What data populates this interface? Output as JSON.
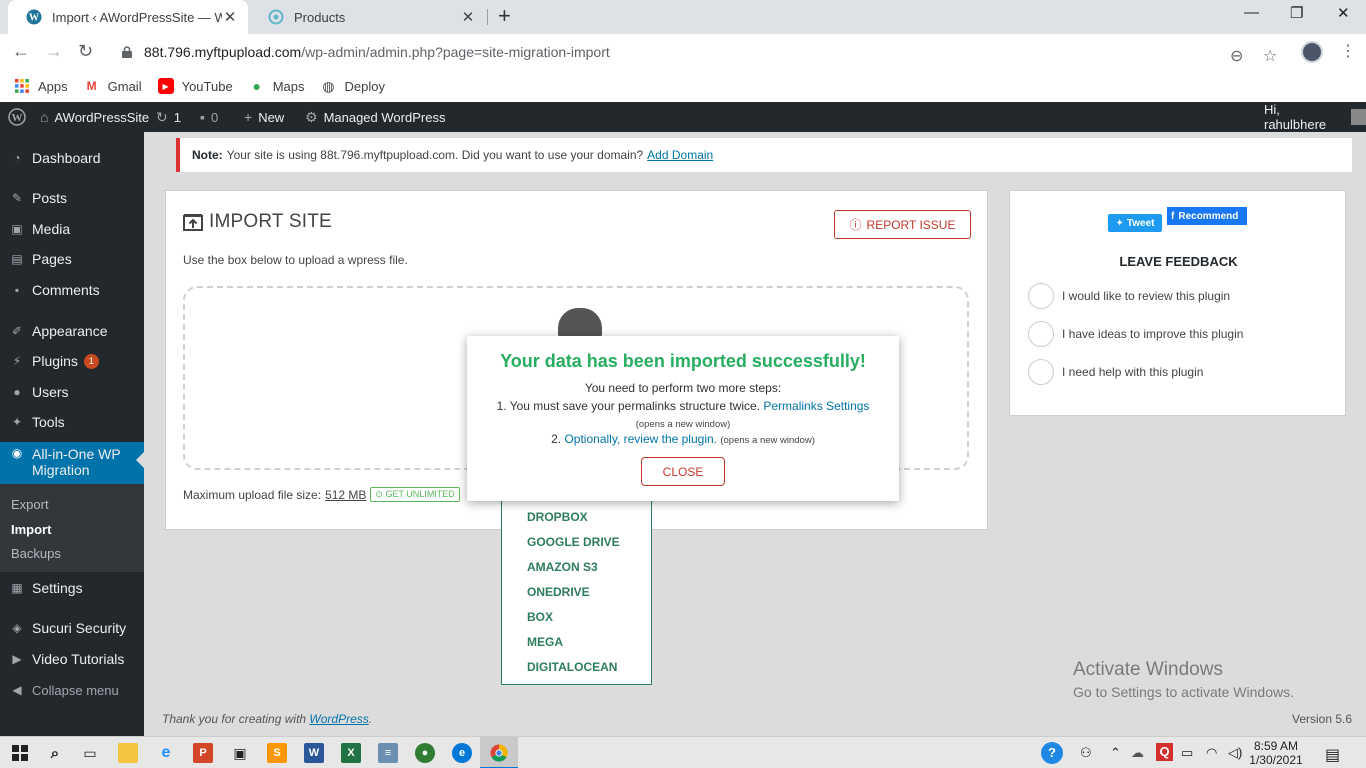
{
  "browser": {
    "tabs": [
      {
        "title": "Import ‹ AWordPressSite — WordPress"
      },
      {
        "title": "Products"
      }
    ],
    "url_host": "88t.796.myftpupload.com",
    "url_path": "/wp-admin/admin.php?page=site-migration-import",
    "bookmarks": [
      {
        "label": "Apps",
        "icon": "apps-grid-icon"
      },
      {
        "label": "Gmail",
        "icon": "gmail-icon"
      },
      {
        "label": "YouTube",
        "icon": "youtube-icon"
      },
      {
        "label": "Maps",
        "icon": "maps-pin-icon"
      },
      {
        "label": "Deploy",
        "icon": "deploy-globe-icon"
      }
    ]
  },
  "adminbar": {
    "site_name": "AWordPressSite",
    "updates_count": "1",
    "comments_count": "0",
    "new_label": "New",
    "managed_label": "Managed WordPress",
    "greeting": "Hi, rahulbhere"
  },
  "sidebar": {
    "items": [
      {
        "label": "Dashboard"
      },
      {
        "label": "Posts"
      },
      {
        "label": "Media"
      },
      {
        "label": "Pages"
      },
      {
        "label": "Comments"
      },
      {
        "label": "Appearance"
      },
      {
        "label": "Plugins",
        "badge": "1"
      },
      {
        "label": "Users"
      },
      {
        "label": "Tools"
      },
      {
        "label": "All-in-One WP Migration"
      },
      {
        "label": "Settings"
      },
      {
        "label": "Sucuri Security"
      },
      {
        "label": "Video Tutorials"
      },
      {
        "label": "Collapse menu"
      }
    ],
    "submenu": [
      "Export",
      "Import",
      "Backups"
    ]
  },
  "notice": {
    "label": "Note:",
    "text_before": "Your site is using",
    "domain": "88t.796.myftpupload.com.",
    "text_after": "Did you want to use your domain?",
    "link": "Add Domain"
  },
  "import_panel": {
    "title": "IMPORT SITE",
    "report_button": "REPORT ISSUE",
    "description": "Use the box below to upload a wpress file.",
    "max_upload_label": "Maximum upload file size:",
    "max_upload_value": "512 MB",
    "get_unlimited": "GET UNLIMITED",
    "providers": [
      "DROPBOX",
      "GOOGLE DRIVE",
      "AMAZON S3",
      "ONEDRIVE",
      "BOX",
      "MEGA",
      "DIGITALOCEAN"
    ]
  },
  "feedback_panel": {
    "tweet_label": "Tweet",
    "recommend_label": "Recommend",
    "title": "LEAVE FEEDBACK",
    "options": [
      "I would like to review this plugin",
      "I have ideas to improve this plugin",
      "I need help with this plugin"
    ]
  },
  "modal": {
    "title": "Your data has been imported successfully!",
    "subtitle": "You need to perform two more steps:",
    "step1_text": "1. You must save your permalinks structure twice.",
    "step1_link": "Permalinks Settings",
    "step1_note": "(opens a new window)",
    "step2_prefix": "2.",
    "step2_link": "Optionally, review the plugin.",
    "step2_note": "(opens a new window)",
    "close_button": "CLOSE"
  },
  "footer": {
    "thanks_text": "Thank you for creating with",
    "thanks_link": "WordPress",
    "thanks_end": ".",
    "version": "Version 5.6"
  },
  "watermark": {
    "line1": "Activate Windows",
    "line2": "Go to Settings to activate Windows."
  },
  "taskbar": {
    "time": "8:59 AM",
    "date": "1/30/2021"
  },
  "colors": {
    "wp_dark": "#23282d",
    "wp_blue": "#0073aa",
    "success_green": "#27ae60",
    "issue_red": "#c0392b",
    "provider_green": "#2e7d5b"
  }
}
